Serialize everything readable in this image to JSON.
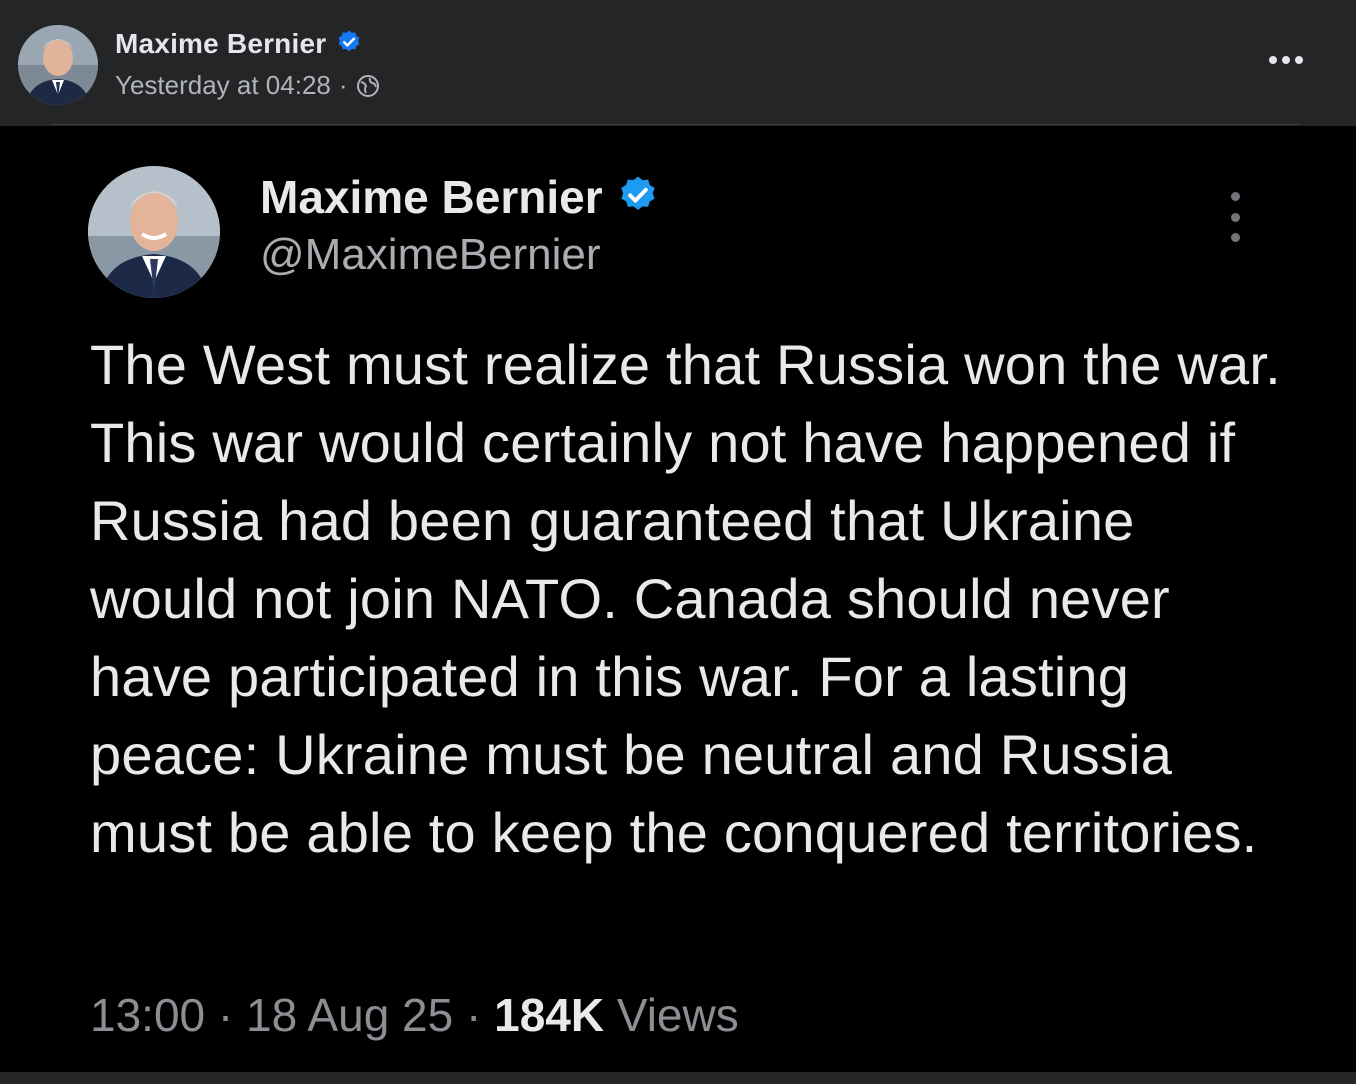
{
  "facebook_post": {
    "author_name": "Maxime Bernier",
    "timestamp": "Yesterday at 04:28",
    "separator": "·",
    "audience_icon": "globe-icon",
    "more_icon": "ellipsis-horizontal-icon"
  },
  "tweet": {
    "author_name": "Maxime Bernier",
    "handle": "@MaximeBernier",
    "verified_icon": "verified-badge-icon",
    "more_icon": "ellipsis-vertical-icon",
    "text": "The West must realize that Russia won the war. This war would certainly not have happened if Russia had been guaranteed that Ukraine would not join NATO. Canada should never have participated in this war. For a lasting peace: Ukraine must be neutral and Russia must be able to keep the conquered territories.",
    "time": "13:00",
    "date": "18 Aug 25",
    "sep": "·",
    "views_count": "184K",
    "views_label": "Views"
  },
  "colors": {
    "fb_background": "#242526",
    "tweet_background": "#000000",
    "verified_blue": "#1d9bf0",
    "fb_verified_blue": "#1877f2"
  }
}
